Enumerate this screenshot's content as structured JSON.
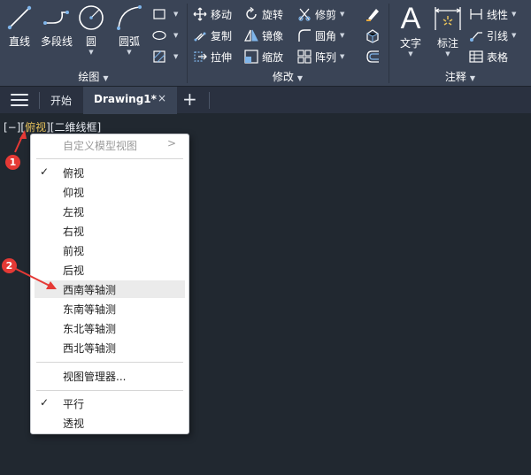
{
  "ribbon": {
    "draw": {
      "line_label": "直线",
      "polyline_label": "多段线",
      "circle_label": "圆",
      "arc_label": "圆弧",
      "panel_title": "绘图"
    },
    "modify": {
      "move_label": "移动",
      "rotate_label": "旋转",
      "trim_label": "修剪",
      "copy_label": "复制",
      "mirror_label": "镜像",
      "fillet_label": "圆角",
      "stretch_label": "拉伸",
      "scale_label": "缩放",
      "array_label": "阵列",
      "panel_title": "修改"
    },
    "annotation": {
      "text_label": "文字",
      "dimension_label": "标注",
      "linear_label": "线性",
      "leader_label": "引线",
      "table_label": "表格",
      "panel_title": "注释",
      "text_glyph": "A"
    }
  },
  "tabs": {
    "start": "开始",
    "active": "Drawing1*",
    "close": "×",
    "add": "+"
  },
  "viewport": {
    "control_bracket_open": "[−][",
    "view_name": "俯视",
    "control_rest": "][二维线框]"
  },
  "context_menu": {
    "custom_views": "自定义模型视图",
    "items": [
      "俯视",
      "仰视",
      "左视",
      "右视",
      "前视",
      "后视",
      "西南等轴测",
      "东南等轴测",
      "东北等轴测",
      "西北等轴测"
    ],
    "view_manager": "视图管理器...",
    "parallel": "平行",
    "perspective": "透视",
    "checkmark": "✓",
    "submenu_arrow": ">"
  },
  "annotations": {
    "step1": "1",
    "step2": "2"
  },
  "colors": {
    "background": "#212830",
    "ribbon": "#3a4456",
    "highlight_view": "#e6c25b",
    "badge_red": "#e53935",
    "icon_blue": "#7fb5ea"
  }
}
